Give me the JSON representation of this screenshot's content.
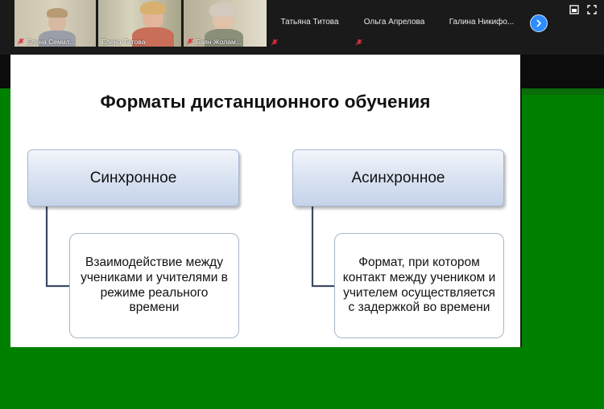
{
  "participants_strip": {
    "video_tiles": [
      {
        "name": "Елена Семил...",
        "muted": true,
        "active": false
      },
      {
        "name": "Елена Титова",
        "muted": false,
        "active": true
      },
      {
        "name": "Баян Жолам...",
        "muted": true,
        "active": false
      }
    ],
    "name_tiles": [
      {
        "name": "Татьяна Титова",
        "muted": true
      },
      {
        "name": "Ольга Апрелова",
        "muted": true
      },
      {
        "name": "Галина  Никифо...",
        "muted": false
      }
    ],
    "next_page_icon": "chevron-right-icon",
    "window_icons": [
      "minimize-icon",
      "fullscreen-icon"
    ]
  },
  "slide": {
    "title": "Форматы дистанционного обучения",
    "columns": [
      {
        "heading": "Синхронное",
        "description": "Взаимодействие между учениками и учителями в режиме реального времени"
      },
      {
        "heading": "Асинхронное",
        "description": "Формат, при котором контакт между учеником и учителем осуществляется с задержкой во времени"
      }
    ]
  },
  "colors": {
    "background_green": "#008000",
    "strip_background": "#1a1a1a",
    "active_speaker_outline": "#f2d64b",
    "muted_icon": "#e0323b",
    "next_button": "#2d8cff"
  }
}
